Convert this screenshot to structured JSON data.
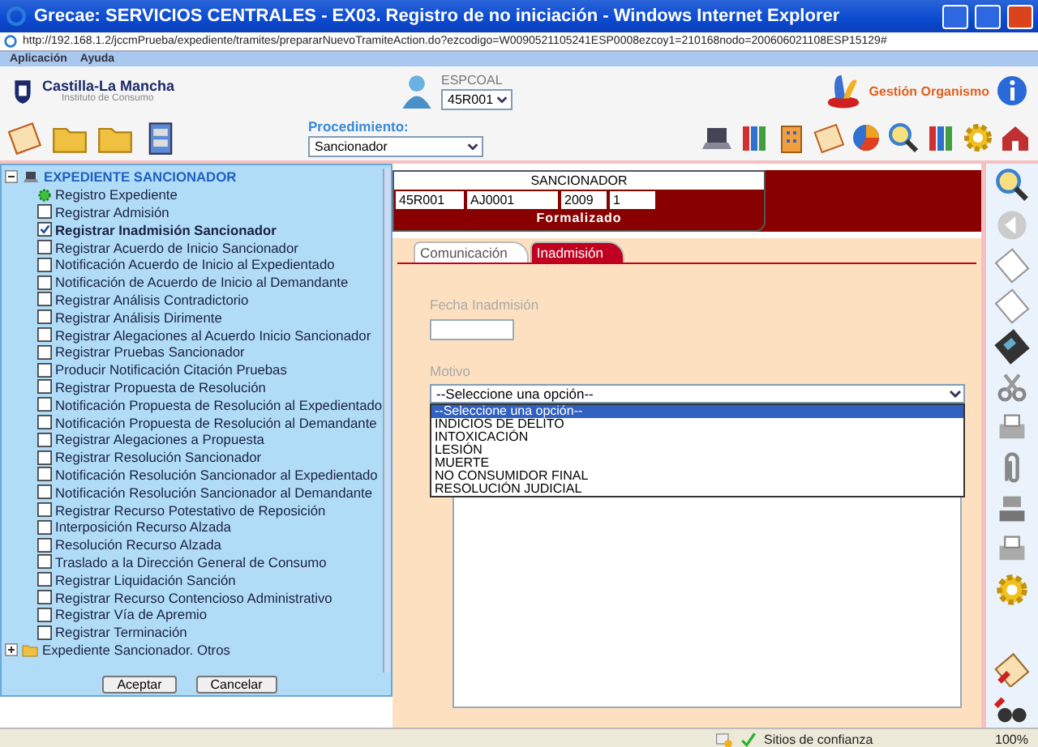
{
  "window": {
    "title": "Grecae: SERVICIOS CENTRALES - EX03. Registro de no iniciación - Windows Internet Explorer",
    "address": "http://192.168.1.2/jccmPrueba/expediente/tramites/prepararNuevoTramiteAction.do?ezcodigo=W0090521105241ESP0008ezcoy1=210168nodo=200606021108ESP15129#"
  },
  "menu": [
    "Aplicación",
    "Ayuda"
  ],
  "header": {
    "logo_title": "Castilla-La Mancha",
    "logo_subtitle": "Instituto de Consumo",
    "user": "ESPCOAL",
    "user_select": "45R001",
    "org": "Gestión Organismo"
  },
  "procedimiento": {
    "label": "Procedimiento:",
    "value": "Sancionador"
  },
  "tree": [
    {
      "label": "EXPEDIENTE SANCIONADOR",
      "expanded": true,
      "children": [
        {
          "label": "Registro Expediente",
          "kind": "gear",
          "checked": false
        },
        {
          "label": "Registrar Admisión",
          "kind": "checkbox",
          "checked": false
        },
        {
          "label": "Registrar Inadmisión Sancionador",
          "kind": "checkbox",
          "checked": true
        },
        {
          "label": "Registrar Acuerdo de Inicio Sancionador",
          "kind": "checkbox",
          "checked": false
        },
        {
          "label": "Notificación Acuerdo de Inicio al Expedientado",
          "kind": "checkbox",
          "checked": false
        },
        {
          "label": "Notificación de Acuerdo de Inicio al Demandante",
          "kind": "checkbox",
          "checked": false
        },
        {
          "label": "Registrar Análisis Contradictorio",
          "kind": "checkbox",
          "checked": false
        },
        {
          "label": "Registrar Análisis Dirimente",
          "kind": "checkbox",
          "checked": false
        },
        {
          "label": "Registrar Alegaciones al Acuerdo Inicio Sancionador",
          "kind": "checkbox",
          "checked": false
        },
        {
          "label": "Registrar Pruebas Sancionador",
          "kind": "checkbox",
          "checked": false
        },
        {
          "label": "Producir Notificación Citación Pruebas",
          "kind": "checkbox",
          "checked": false
        },
        {
          "label": "Registrar Propuesta de Resolución",
          "kind": "checkbox",
          "checked": false
        },
        {
          "label": "Notificación Propuesta de Resolución al Expedientado",
          "kind": "checkbox",
          "checked": false
        },
        {
          "label": "Notificación Propuesta de Resolución al Demandante",
          "kind": "checkbox",
          "checked": false
        },
        {
          "label": "Registrar Alegaciones a Propuesta",
          "kind": "checkbox",
          "checked": false
        },
        {
          "label": "Registrar Resolución Sancionador",
          "kind": "checkbox",
          "checked": false
        },
        {
          "label": "Notificación Resolución Sancionador al Expedientado",
          "kind": "checkbox",
          "checked": false
        },
        {
          "label": "Notificación Resolución Sancionador al Demandante",
          "kind": "checkbox",
          "checked": false
        },
        {
          "label": "Registrar Recurso Potestativo de Reposición",
          "kind": "checkbox",
          "checked": false
        },
        {
          "label": "Interposición Recurso Alzada",
          "kind": "checkbox",
          "checked": false
        },
        {
          "label": "Resolución Recurso Alzada",
          "kind": "checkbox",
          "checked": false
        },
        {
          "label": "Traslado a la Dirección General de Consumo",
          "kind": "checkbox",
          "checked": false
        },
        {
          "label": "Registrar Liquidación Sanción",
          "kind": "checkbox",
          "checked": false
        },
        {
          "label": "Registrar Recurso Contencioso Administrativo",
          "kind": "checkbox",
          "checked": false
        },
        {
          "label": "Registrar Vía de Apremio",
          "kind": "checkbox",
          "checked": false
        },
        {
          "label": "Registrar Terminación",
          "kind": "checkbox",
          "checked": false
        }
      ]
    },
    {
      "label": "Expediente Sancionador. Otros",
      "expanded": false
    }
  ],
  "tree_buttons": [
    "Aceptar",
    "Cancelar"
  ],
  "record": {
    "title": "SANCIONADOR",
    "cells": [
      "45R001",
      "AJ0001",
      "2009",
      "1"
    ],
    "status": "Formalizado"
  },
  "tabs": [
    {
      "label": "Comunicación",
      "selected": false
    },
    {
      "label": "Inadmisión",
      "selected": true
    }
  ],
  "form": {
    "fecha_label": "Fecha Inadmisión",
    "motivo_label": "Motivo",
    "motivo_value": "--Seleccione una opción--",
    "options": [
      {
        "label": "--Seleccione una opción--",
        "selected": true
      },
      {
        "label": "INDICIOS DE DELITO",
        "selected": false
      },
      {
        "label": "INTOXICACIÓN",
        "selected": false
      },
      {
        "label": "LESIÓN",
        "selected": false
      },
      {
        "label": "MUERTE",
        "selected": false
      },
      {
        "label": "NO CONSUMIDOR FINAL",
        "selected": false
      },
      {
        "label": "RESOLUCIÓN JUDICIAL",
        "selected": false
      }
    ]
  },
  "status_bar": {
    "zone": "Sitios de confianza",
    "zoom": "100%"
  }
}
